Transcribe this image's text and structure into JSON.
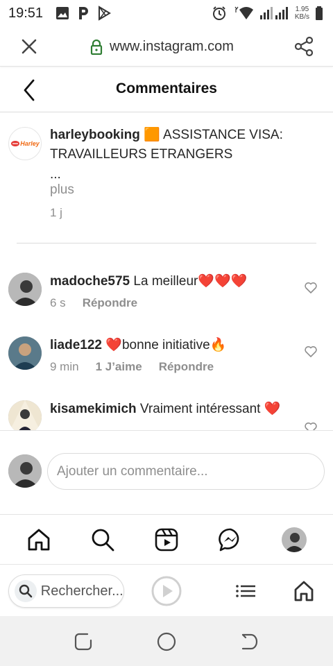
{
  "status_bar": {
    "time": "19:51",
    "net_speed_value": "1.95",
    "net_speed_unit": "KB/s"
  },
  "browser": {
    "url": "www.instagram.com",
    "search_placeholder": "Rechercher..."
  },
  "header": {
    "title": "Commentaires"
  },
  "post_caption": {
    "username": "harleybooking",
    "emoji": "🟧",
    "text": "ASSISTANCE VISA: TRAVAILLEURS ETRANGERS",
    "ellipsis": "...",
    "more": "plus",
    "age": "1 j",
    "avatar_text": "Harley"
  },
  "comments": [
    {
      "username": "madoche575",
      "text": "La meilleur❤️❤️❤️",
      "age": "6 s",
      "likes": "",
      "reply": "Répondre"
    },
    {
      "username": "liade122",
      "text": "❤️bonne initiative🔥",
      "age": "9 min",
      "likes": "1 J’aime",
      "reply": "Répondre"
    },
    {
      "username": "kisamekimich",
      "text": "Vraiment intéressant ❤️",
      "age": "",
      "likes": "",
      "reply": ""
    }
  ],
  "add_comment": {
    "placeholder": "Ajouter un commentaire..."
  },
  "colors": {
    "text": "#262626",
    "secondary": "#8e8e8e",
    "divider": "#dbdbdb",
    "secure": "#2e7d32",
    "brand_orange": "#f06a14"
  },
  "icons": {
    "status": [
      "gallery-icon",
      "p-icon",
      "play-store-icon",
      "alarm-icon",
      "wifi-icon",
      "signal-icon",
      "battery-icon"
    ],
    "tabbar": [
      "home-icon",
      "search-icon",
      "reels-icon",
      "messenger-icon",
      "profile-avatar"
    ],
    "browserbar": [
      "search-icon",
      "play-icon",
      "list-icon",
      "home-icon"
    ],
    "system_nav": [
      "recents-icon",
      "home-circle-icon",
      "back-icon"
    ]
  }
}
